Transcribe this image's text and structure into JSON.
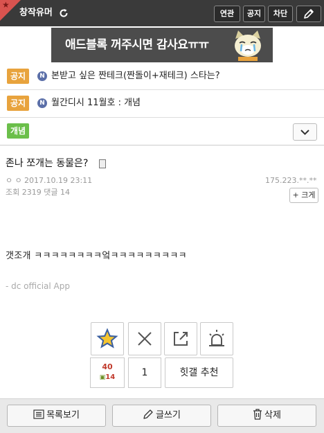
{
  "header": {
    "gallery_name": "창작유머",
    "buttons": {
      "related": "연관",
      "notice": "공지",
      "block": "차단"
    }
  },
  "banner": {
    "text": "애드블록 꺼주시면 감사요ㅠㅠ"
  },
  "notices": [
    {
      "tag": "공지",
      "badge": "N",
      "text": "본받고 싶은 짠테크(짠돌이+재테크) 스타는?"
    },
    {
      "tag": "공지",
      "badge": "N",
      "text": "월간디시 11월호 : 개념"
    }
  ],
  "concept_tab": {
    "label": "개념"
  },
  "post": {
    "title": "존나 쪼개는 동물은?",
    "author": "ㅇ ㅇ",
    "datetime": "2017.10.19 23:11",
    "ip": "175.223.**.**",
    "stats": "조회 2319 댓글 14",
    "enlarge_label": "+ 크게",
    "body": "갯조개 ㅋㅋㅋㅋㅋㅋㅋㅋ엌ㅋㅋㅋㅋㅋㅋㅋㅋㅋ",
    "signature": "- dc official App"
  },
  "actions": {
    "recommend_count": "40",
    "fixed_recommend_count": "14",
    "dislike_count": "1",
    "heot_label": "힛갤 추천"
  },
  "footer": {
    "list_label": "목록보기",
    "write_label": "글쓰기",
    "delete_label": "삭제"
  },
  "colors": {
    "topbar": "#3a3a3a",
    "notice_tag": "#e8a33d",
    "concept_tag": "#6bbf4a",
    "corner": "#d9534f",
    "recommend": "#c0392b"
  }
}
